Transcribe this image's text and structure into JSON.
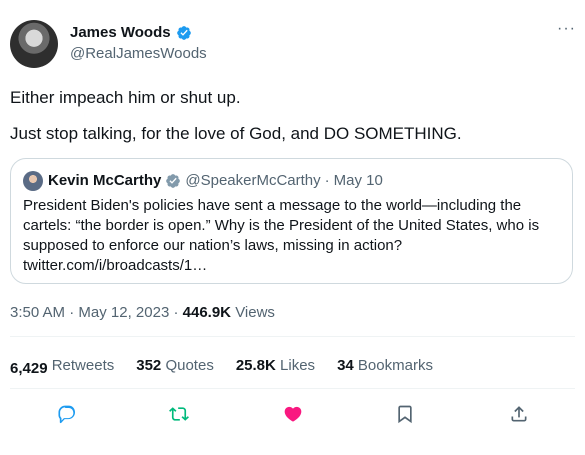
{
  "author": {
    "name": "James Woods",
    "handle": "@RealJamesWoods",
    "verified": true
  },
  "more_icon": "more-icon",
  "tweet": {
    "line1": "Either impeach him or shut up.",
    "line2": "Just stop talking, for the love of God, and DO SOMETHING."
  },
  "quote": {
    "name": "Kevin McCarthy",
    "handle": "@SpeakerMcCarthy",
    "separator": "·",
    "date": "May 10",
    "lines": [
      "President Biden's policies have sent a message to the world—including the",
      "cartels: “the border is open.”  Why is the President of the United States, who is",
      "supposed to enforce our nation’s laws, missing in action?",
      "twitter.com/i/broadcasts/1…"
    ]
  },
  "meta": {
    "time": "3:50 AM",
    "separator1": "·",
    "date": "May 12, 2023",
    "separator2": "·",
    "views_value": "446.9K",
    "views_label": "Views"
  },
  "stats": {
    "retweets_value": "6,429",
    "retweets_label": "Retweets",
    "quotes_value": "352",
    "quotes_label": "Quotes",
    "likes_value": "25.8K",
    "likes_label": "Likes",
    "bookmarks_value": "34",
    "bookmarks_label": "Bookmarks"
  },
  "actions": [
    "reply-icon",
    "retweet-icon",
    "like-icon",
    "bookmark-icon",
    "share-icon"
  ],
  "colors": {
    "verified": "#1d9bf0",
    "retweet": "#00ba7c",
    "like": "#f91880",
    "secondary_text": "#536471"
  }
}
